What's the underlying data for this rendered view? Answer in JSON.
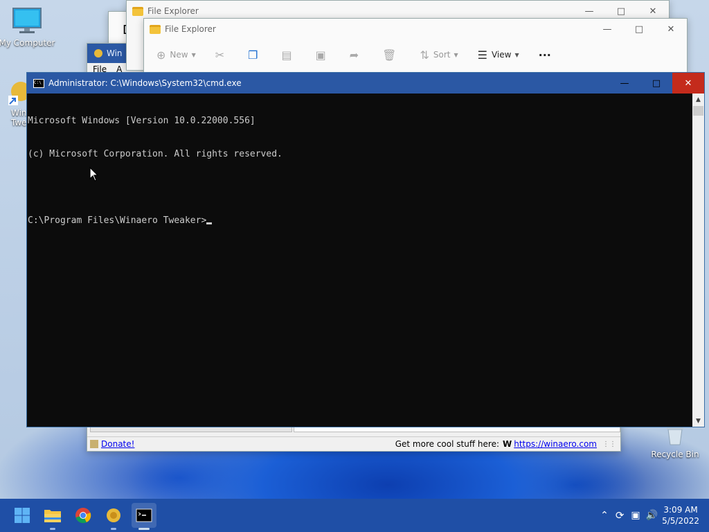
{
  "desktop": {
    "icons": [
      {
        "label": "My Computer"
      },
      {
        "label": "Recycle Bin"
      }
    ],
    "partial_shortcut": {
      "line1": "Win",
      "line2": "Twe"
    }
  },
  "explorer_back": {
    "title": "File Explorer"
  },
  "explorer_front": {
    "title": "File Explorer",
    "toolbar": {
      "new_label": "New",
      "sort_label": "Sort",
      "view_label": "View",
      "more_label": "···"
    }
  },
  "winaero_partial": {
    "title": "Win",
    "menu_file": "File",
    "menu_a": "A"
  },
  "background_window_letter": "D",
  "cmd": {
    "title": "Administrator: C:\\Windows\\System32\\cmd.exe",
    "lines": [
      "Microsoft Windows [Version 10.0.22000.556]",
      "(c) Microsoft Corporation. All rights reserved.",
      "",
      "C:\\Program Files\\Winaero Tweaker>"
    ]
  },
  "winaero_status": {
    "donate_label": "Donate!",
    "more_text": "Get more cool stuff here:",
    "w_glyph": "W",
    "link_label": "https://winaero.com"
  },
  "taskbar": {
    "clock_time": "3:09 AM",
    "clock_date": "5/5/2022"
  },
  "colors": {
    "taskbar": "#1f4fa6",
    "cmd_title": "#2b58a4",
    "close_red": "#c42b1c",
    "console_bg": "#0c0c0c",
    "console_text": "#cccccc"
  }
}
